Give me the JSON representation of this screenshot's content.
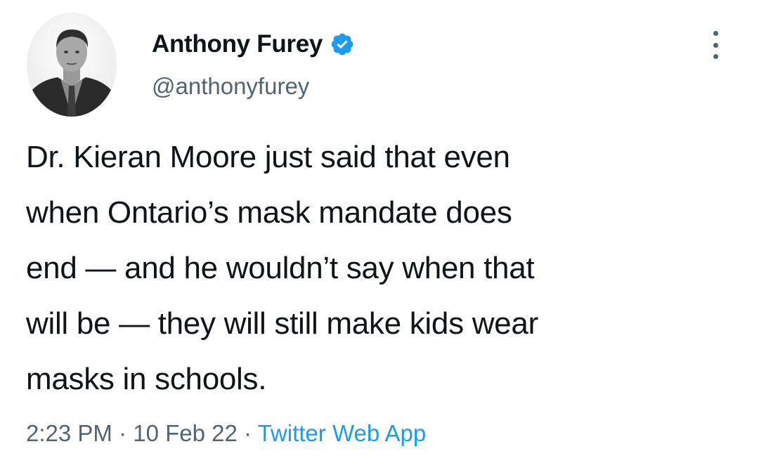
{
  "author": {
    "display_name": "Anthony Furey",
    "handle": "@anthonyfurey",
    "verified": true,
    "avatar_icon": "profile-photo"
  },
  "tweet": {
    "text_lines": [
      "Dr. Kieran Moore just said that even",
      "when Ontario’s mask mandate does",
      "end — and he wouldn’t say when that",
      "will be — they will still make kids wear",
      "masks in schools."
    ]
  },
  "meta": {
    "time": "2:23 PM",
    "separator": " · ",
    "date": "10 Feb 22",
    "source": "Twitter Web App"
  },
  "colors": {
    "verified_badge": "#1d9bf0",
    "source_link": "#1d9bf0",
    "secondary_text": "#536471",
    "primary_text": "#0f1419"
  },
  "icons": {
    "verified": "verified-badge-icon",
    "more": "more-options-icon"
  }
}
